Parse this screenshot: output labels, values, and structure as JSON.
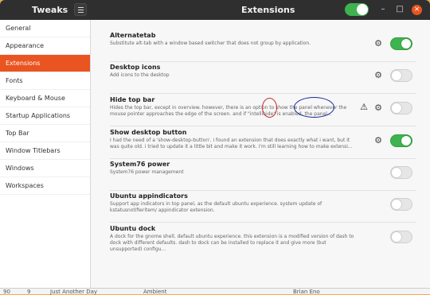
{
  "window": {
    "app_title": "Tweaks",
    "page_title": "Extensions",
    "min_symbol": "–",
    "max_symbol": "□",
    "close_symbol": "×"
  },
  "sidebar": {
    "items": [
      {
        "label": "General"
      },
      {
        "label": "Appearance"
      },
      {
        "label": "Extensions"
      },
      {
        "label": "Fonts"
      },
      {
        "label": "Keyboard & Mouse"
      },
      {
        "label": "Startup Applications"
      },
      {
        "label": "Top Bar"
      },
      {
        "label": "Window Titlebars"
      },
      {
        "label": "Windows"
      },
      {
        "label": "Workspaces"
      }
    ]
  },
  "extensions": [
    {
      "name": "Alternatetab",
      "description": "Substitute alt-tab with a window based switcher that does not group by application.",
      "enabled": true,
      "has_settings": true,
      "warning": false
    },
    {
      "name": "Desktop icons",
      "description": "Add icons to the desktop",
      "enabled": false,
      "has_settings": true,
      "warning": false
    },
    {
      "name": "Hide top bar",
      "description": "Hides the top bar, except in overview. however, there is an option to show the panel whenever the mouse pointer approaches the edge of the screen. and if \"intellihide\" is enabled, the panel...",
      "enabled": false,
      "has_settings": true,
      "warning": true
    },
    {
      "name": "Show desktop button",
      "description": "I had the need of a 'show-desktop-button'. i found an extension that does exactly what i want, but it was quite old. i tried to update it a little bit and make it work. i'm still learning how to make extensi...",
      "enabled": true,
      "has_settings": true,
      "warning": false
    },
    {
      "name": "System76 power",
      "description": "System76 power management",
      "enabled": false,
      "has_settings": false,
      "warning": false
    },
    {
      "name": "Ubuntu appindicators",
      "description": "Support app indicators in top panel, as the default ubuntu experience. system update of kstatusnotifieritem/ appindicator extension.",
      "enabled": false,
      "has_settings": false,
      "warning": false
    },
    {
      "name": "Ubuntu dock",
      "description": "A dock for the gnome shell, default ubuntu experience. this extension is a modified version of dash to dock with different defaults. dash to dock can be installed to replace it and give more (but unsupported) configu...",
      "enabled": false,
      "has_settings": false,
      "warning": false
    }
  ],
  "icons": {
    "gear": "gear-icon",
    "warning": "warning-triangle-icon"
  },
  "colors": {
    "accent": "#e95420",
    "toggle_on": "#3eb34f",
    "titlebar": "#2f2f2f"
  },
  "background_row": [
    "90",
    "9",
    "Just Another Day",
    "Ambient",
    "Brian Eno"
  ]
}
